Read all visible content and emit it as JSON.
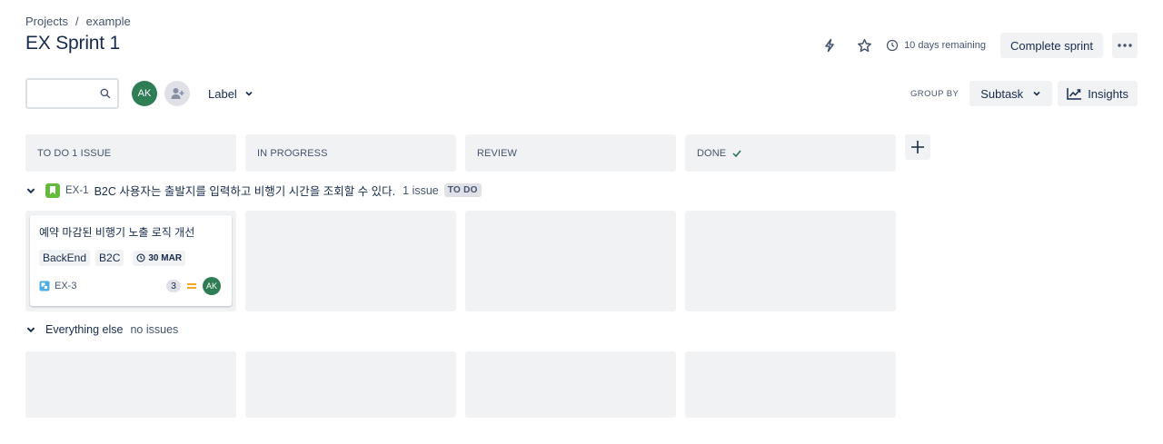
{
  "breadcrumb": {
    "root": "Projects",
    "separator": "/",
    "current": "example"
  },
  "page_title": "EX Sprint 1",
  "header": {
    "remaining": "10 days remaining",
    "complete_sprint": "Complete sprint"
  },
  "toolbar": {
    "search_placeholder": "",
    "avatar_initials": "AK",
    "label_filter": "Label",
    "group_by_label": "GROUP BY",
    "group_by_value": "Subtask",
    "insights": "Insights"
  },
  "columns": [
    {
      "label": "TO DO 1 ISSUE"
    },
    {
      "label": "IN PROGRESS"
    },
    {
      "label": "REVIEW"
    },
    {
      "label": "DONE"
    }
  ],
  "swimlane": {
    "key": "EX-1",
    "title": "B2C 사용자는 출발지를 입력하고 비행기 시간을 조회할 수 있다.",
    "count": "1 issue",
    "status": "TO DO"
  },
  "card": {
    "title": "예약 마감된 비행기 노출 로직 개선",
    "tags": [
      "BackEnd",
      "B2C"
    ],
    "due": "30 MAR",
    "key": "EX-3",
    "estimate": "3",
    "assignee": "AK"
  },
  "else_lane": {
    "title": "Everything else",
    "count": "no issues"
  },
  "colors": {
    "accent_avatar": "#2e7d55",
    "epic_green": "#63ba3c",
    "priority_medium": "#f5a623",
    "column_bg": "#f1f2f4"
  }
}
